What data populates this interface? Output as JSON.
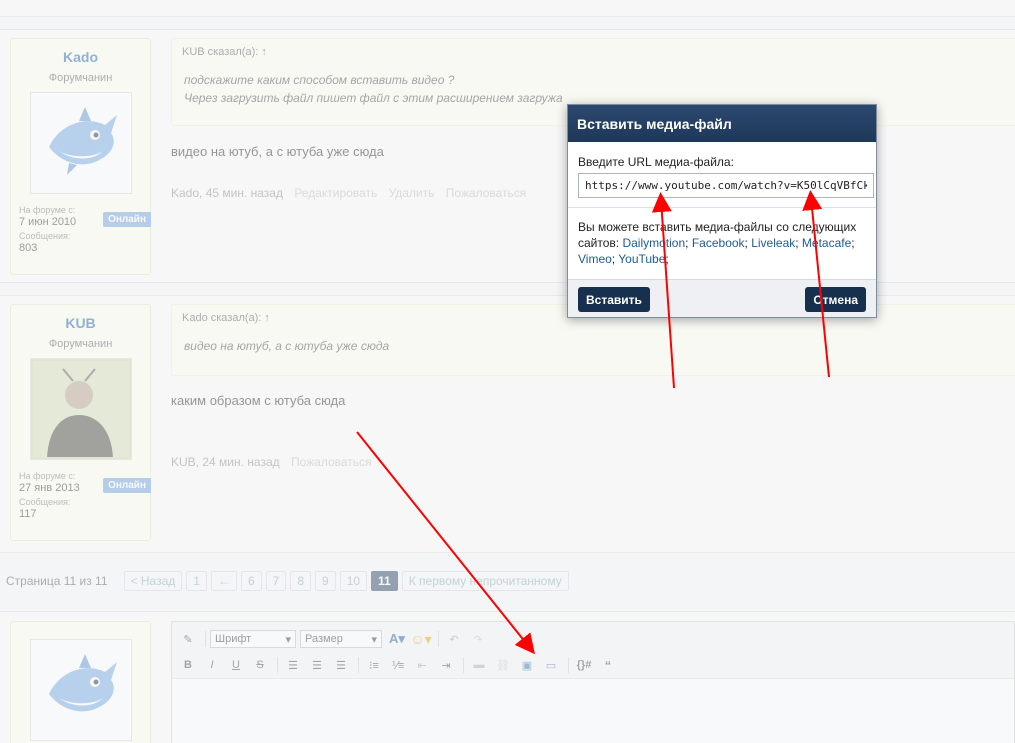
{
  "posts": [
    {
      "username": "Kado",
      "user_title": "Форумчанин",
      "online": "Онлайн",
      "joined_label": "На форуме с:",
      "joined": "7 июн 2010",
      "messages_label": "Сообщения:",
      "messages": "803",
      "quote_head": "KUB сказал(а): ↑",
      "quote_lines": [
        "подскажите каким способом вставить видео ?",
        "Через загрузить файл пишет файл с этим расширением загружа"
      ],
      "message": "видео на ютуб, а с ютуба уже сюда",
      "meta_time": "Kado, 45 мин. назад",
      "actions": [
        "Редактировать",
        "Удалить",
        "Пожаловаться"
      ]
    },
    {
      "username": "KUB",
      "user_title": "Форумчанин",
      "online": "Онлайн",
      "joined_label": "На форуме с:",
      "joined": "27 янв 2013",
      "messages_label": "Сообщения:",
      "messages": "117",
      "quote_head": "Kado сказал(а): ↑",
      "quote_lines": [
        "видео на ютуб, а с ютуба уже сюда"
      ],
      "message": "каким образом с ютуба сюда",
      "meta_time": "KUB, 24 мин. назад",
      "actions": [
        "Пожаловаться"
      ]
    }
  ],
  "pagination": {
    "label": "Страница 11 из 11",
    "prev": "< Назад",
    "first": "1",
    "gap": "←",
    "pages": [
      "6",
      "7",
      "8",
      "9",
      "10"
    ],
    "current": "11",
    "unread": "К первому непрочитанному"
  },
  "editor": {
    "font_select": "Шрифт",
    "size_select": "Размер"
  },
  "modal": {
    "title": "Вставить медиа-файл",
    "url_label": "Введите URL медиа-файла:",
    "url_value": "https://www.youtube.com/watch?v=K50lCqVBfCk",
    "note_prefix": "Вы можете вставить медиа-файлы со следующих сайтов:",
    "sites": [
      "Dailymotion",
      "Facebook",
      "Liveleak",
      "Metacafe",
      "Vimeo",
      "YouTube"
    ],
    "insert_label": "Вставить",
    "cancel_label": "Отмена"
  },
  "colors": {
    "accent_dark": "#1e3858",
    "link": "#1f5a93",
    "arrow": "#ff0000"
  }
}
